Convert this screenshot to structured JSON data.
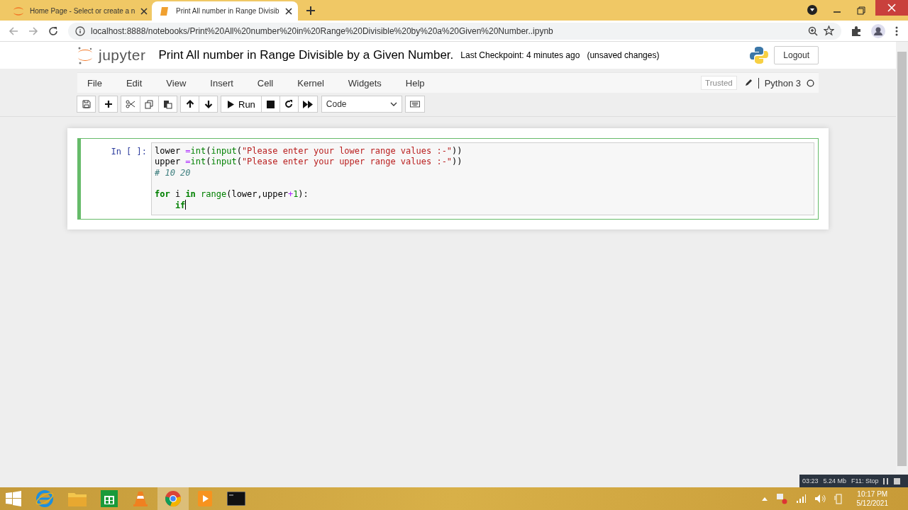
{
  "tabs": [
    {
      "title": "Home Page - Select or create a n",
      "selected": false
    },
    {
      "title": "Print All number in Range Divisib",
      "selected": true
    }
  ],
  "address": "localhost:8888/notebooks/Print%20All%20number%20in%20Range%20Divisible%20by%20a%20Given%20Number..ipynb",
  "header": {
    "logo": "jupyter",
    "notebook_title": "Print All number in Range Divisible by a Given Number.",
    "checkpoint": "Last Checkpoint: 4 minutes ago",
    "unsaved": "(unsaved changes)",
    "logout": "Logout"
  },
  "menu": [
    "File",
    "Edit",
    "View",
    "Insert",
    "Cell",
    "Kernel",
    "Widgets",
    "Help"
  ],
  "trusted": "Trusted",
  "kernel": "Python 3",
  "toolbar": {
    "run": "Run",
    "cell_type": "Code"
  },
  "cell": {
    "prompt": "In [ ]:",
    "selected": true,
    "lines": [
      {
        "kind": "code",
        "tokens": [
          {
            "text": "lower ",
            "kind": "plain"
          },
          {
            "text": "=",
            "kind": "op"
          },
          {
            "text": "int",
            "kind": "builtin"
          },
          {
            "text": "(",
            "kind": "plain"
          },
          {
            "text": "input",
            "kind": "builtin"
          },
          {
            "text": "(",
            "kind": "plain"
          },
          {
            "text": "\"Please enter your lower range values :-\"",
            "kind": "string"
          },
          {
            "text": "))",
            "kind": "plain"
          }
        ]
      },
      {
        "kind": "code",
        "tokens": [
          {
            "text": "upper ",
            "kind": "plain"
          },
          {
            "text": "=",
            "kind": "op"
          },
          {
            "text": "int",
            "kind": "builtin"
          },
          {
            "text": "(",
            "kind": "plain"
          },
          {
            "text": "input",
            "kind": "builtin"
          },
          {
            "text": "(",
            "kind": "plain"
          },
          {
            "text": "\"Please enter your upper range values :-\"",
            "kind": "string"
          },
          {
            "text": "))",
            "kind": "plain"
          }
        ]
      },
      {
        "kind": "code",
        "tokens": [
          {
            "text": "# 10 20",
            "kind": "comment"
          }
        ]
      },
      {
        "kind": "blank"
      },
      {
        "kind": "code",
        "tokens": [
          {
            "text": "for",
            "kind": "keyword"
          },
          {
            "text": " i ",
            "kind": "plain"
          },
          {
            "text": "in ",
            "kind": "keyword"
          },
          {
            "text": "range",
            "kind": "builtin"
          },
          {
            "text": "(lower,upper",
            "kind": "plain"
          },
          {
            "text": "+",
            "kind": "op"
          },
          {
            "text": "1",
            "kind": "number"
          },
          {
            "text": "):",
            "kind": "plain"
          }
        ]
      },
      {
        "kind": "code",
        "tokens": [
          {
            "text": "    if",
            "kind": "keyword"
          }
        ],
        "cursor": true
      }
    ]
  },
  "recorder": {
    "time": "03:23",
    "size": "5.24 Mb",
    "stop": "F11: Stop"
  },
  "clock": {
    "time": "10:17 PM",
    "date": "5/12/2021"
  }
}
